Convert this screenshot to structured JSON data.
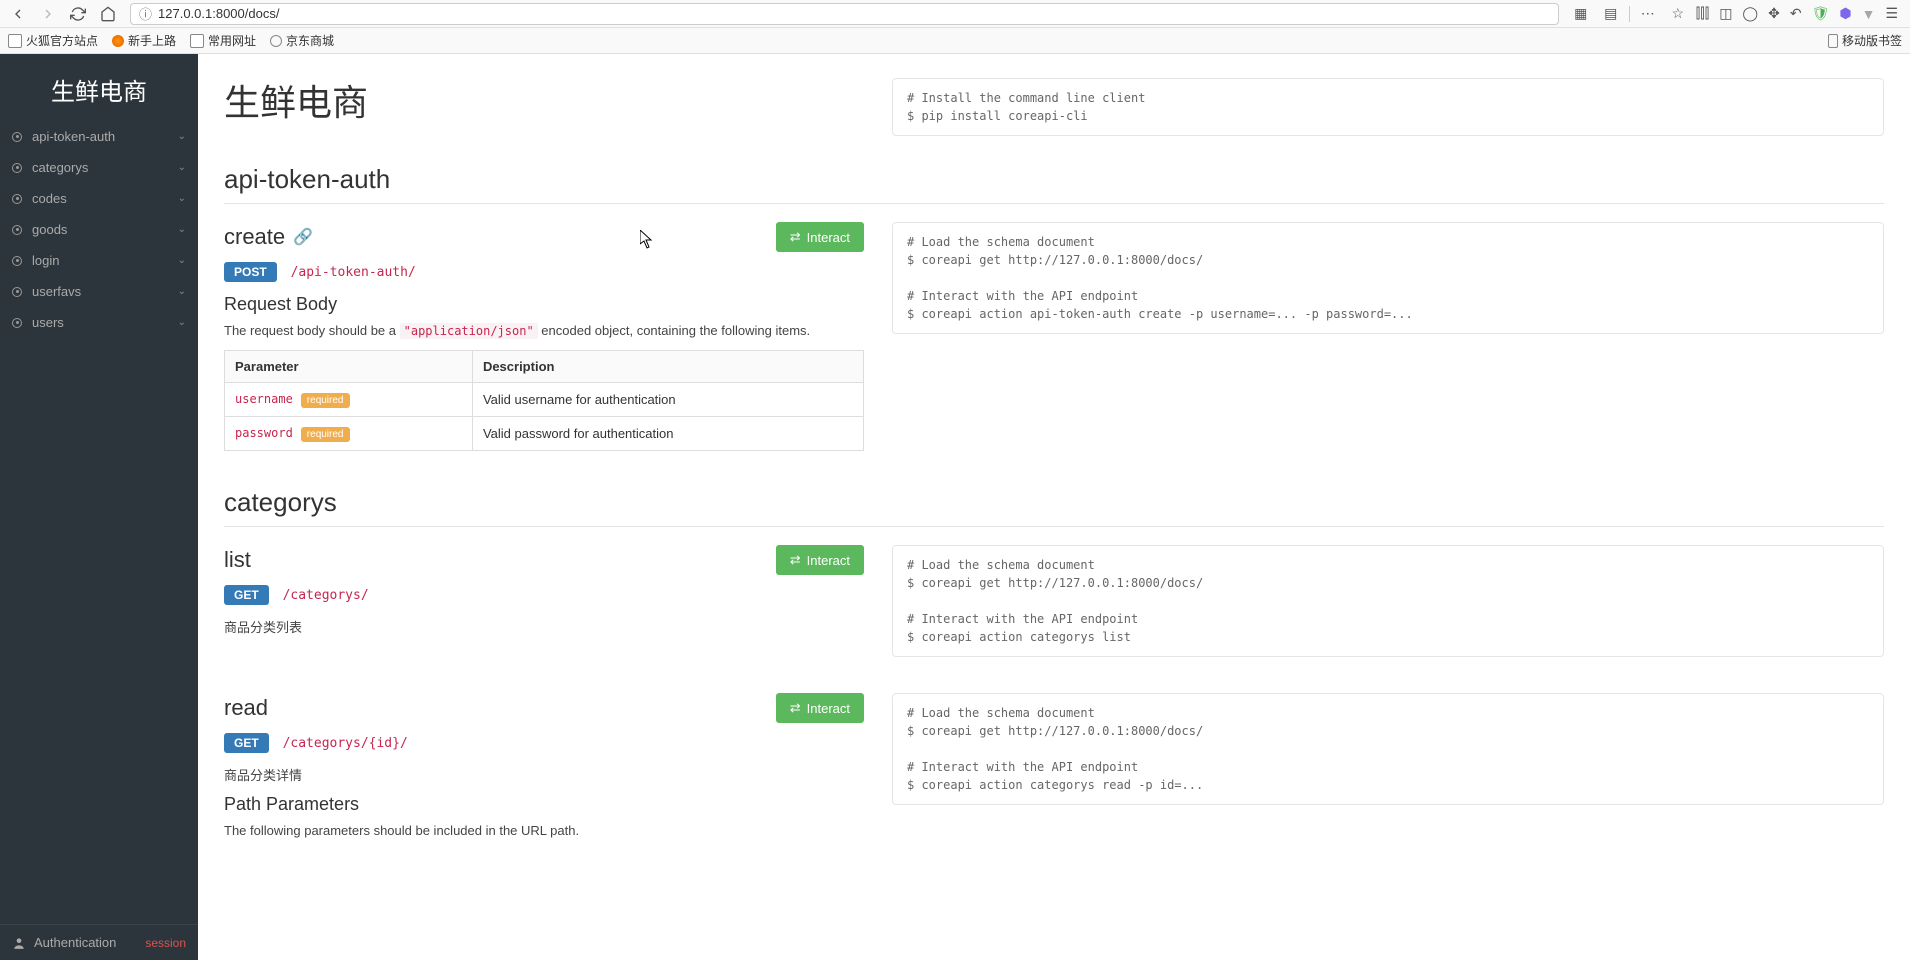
{
  "browser": {
    "url": "127.0.0.1:8000/docs/",
    "bookmarks": [
      "火狐官方站点",
      "新手上路",
      "常用网址",
      "京东商城"
    ],
    "mobile_bookmarks": "移动版书签"
  },
  "sidebar": {
    "title": "生鲜电商",
    "items": [
      {
        "label": "api-token-auth"
      },
      {
        "label": "categorys"
      },
      {
        "label": "codes"
      },
      {
        "label": "goods"
      },
      {
        "label": "login"
      },
      {
        "label": "userfavs"
      },
      {
        "label": "users"
      }
    ],
    "footer": {
      "auth": "Authentication",
      "session": "session"
    }
  },
  "page": {
    "title": "生鲜电商",
    "install_code": "# Install the command line client\n$ pip install coreapi-cli",
    "sections": [
      {
        "name": "api-token-auth",
        "endpoints": [
          {
            "method_name": "create",
            "verb": "POST",
            "path": "/api-token-auth/",
            "interact": "Interact",
            "request_body_h": "Request Body",
            "request_body_text_pre": "The request body should be a ",
            "request_body_code": "\"application/json\"",
            "request_body_text_post": " encoded object, containing the following items.",
            "param_th": [
              "Parameter",
              "Description"
            ],
            "params": [
              {
                "name": "username",
                "required": "required",
                "desc": "Valid username for authentication"
              },
              {
                "name": "password",
                "required": "required",
                "desc": "Valid password for authentication"
              }
            ],
            "code": "# Load the schema document\n$ coreapi get http://127.0.0.1:8000/docs/\n\n# Interact with the API endpoint\n$ coreapi action api-token-auth create -p username=... -p password=..."
          }
        ]
      },
      {
        "name": "categorys",
        "endpoints": [
          {
            "method_name": "list",
            "verb": "GET",
            "path": "/categorys/",
            "interact": "Interact",
            "desc": "商品分类列表",
            "code": "# Load the schema document\n$ coreapi get http://127.0.0.1:8000/docs/\n\n# Interact with the API endpoint\n$ coreapi action categorys list"
          },
          {
            "method_name": "read",
            "verb": "GET",
            "path": "/categorys/{id}/",
            "interact": "Interact",
            "desc": "商品分类详情",
            "path_h": "Path Parameters",
            "path_text": "The following parameters should be included in the URL path.",
            "code": "# Load the schema document\n$ coreapi get http://127.0.0.1:8000/docs/\n\n# Interact with the API endpoint\n$ coreapi action categorys read -p id=..."
          }
        ]
      }
    ]
  }
}
